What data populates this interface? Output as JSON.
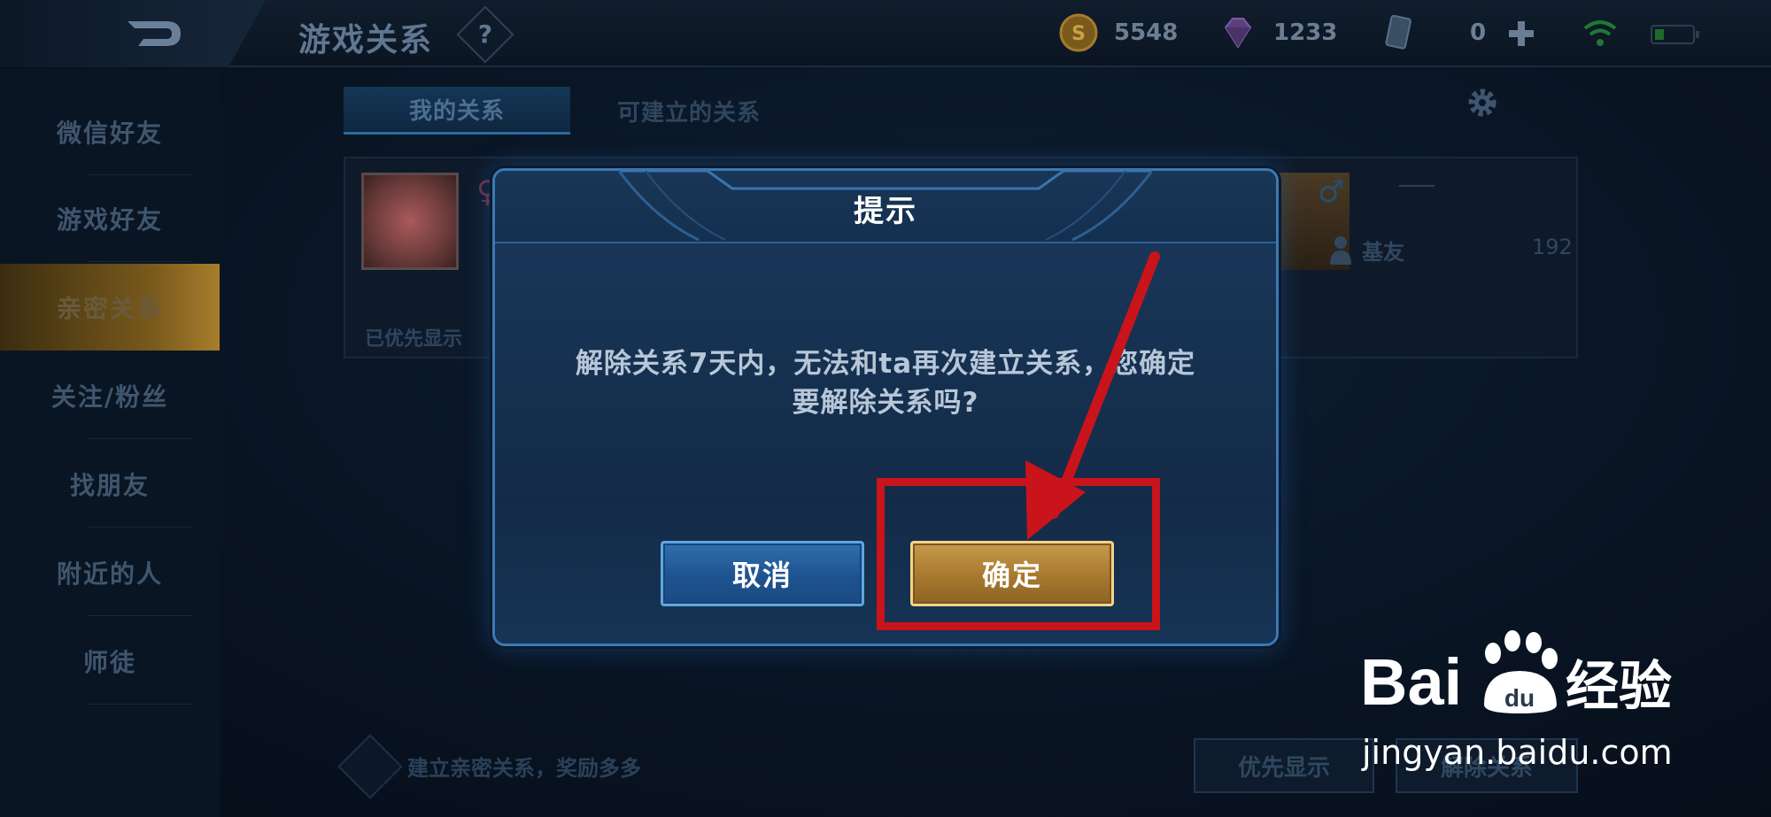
{
  "header": {
    "title": "游戏关系",
    "help_label": "?",
    "gold": "5548",
    "gems": "1233",
    "tickets": "0"
  },
  "sidebar": {
    "items": [
      {
        "label": "微信好友"
      },
      {
        "label": "游戏好友"
      },
      {
        "label": "亲密关系",
        "active": true
      },
      {
        "label": "关注/粉丝"
      },
      {
        "label": "找朋友"
      },
      {
        "label": "附近的人"
      },
      {
        "label": "师徒"
      }
    ]
  },
  "tabs": [
    {
      "label": "我的关系",
      "active": true
    },
    {
      "label": "可建立的关系"
    }
  ],
  "card": {
    "priority_label": "已优先显示",
    "relation_label": "基友",
    "relation_value": "192"
  },
  "footer": {
    "hint": "建立亲密关系，奖励多多",
    "priority_button": "优先显示",
    "remove_button": "解除关系"
  },
  "dialog": {
    "title": "提示",
    "message_line1": "解除关系7天内，无法和ta再次建立关系，您确定",
    "message_line2": "要解除关系吗?",
    "cancel_label": "取消",
    "confirm_label": "确定"
  },
  "watermark": {
    "logo_text": "Bai 经验",
    "url": "jingyan.baidu.com"
  },
  "colors": {
    "accent_gold": "#c69a4c",
    "accent_blue": "#2f6fae",
    "annotation_red": "#c8141a"
  },
  "icons": [
    "back-arrow-icon",
    "help-icon",
    "gold-coin-icon",
    "gem-icon",
    "ticket-icon",
    "plus-icon",
    "wifi-icon",
    "battery-icon",
    "gear-icon",
    "female-icon",
    "male-icon",
    "relation-icon"
  ]
}
